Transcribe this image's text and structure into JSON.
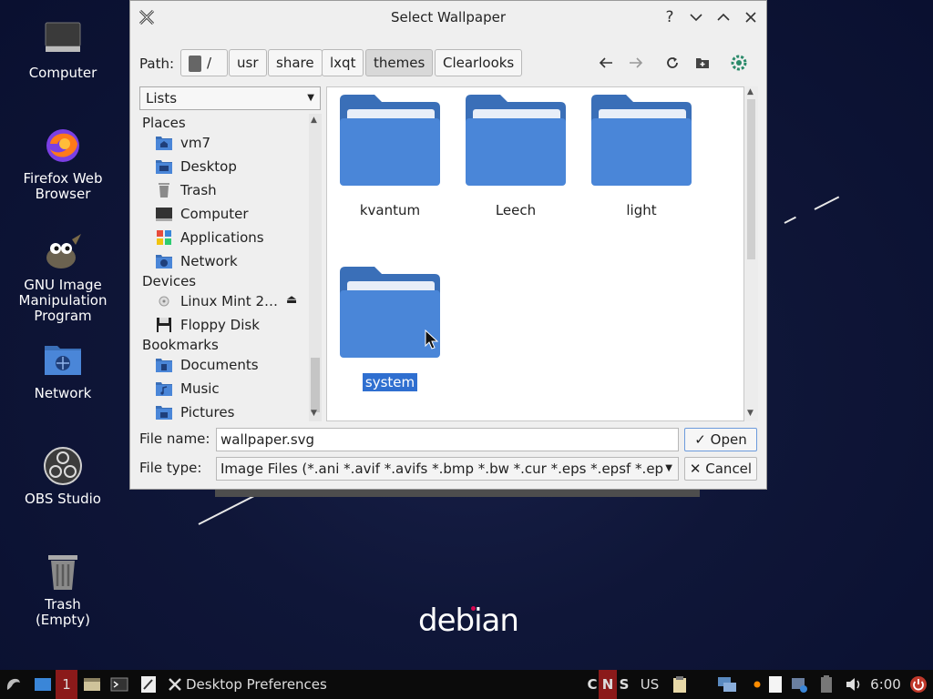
{
  "desktop": {
    "icons": [
      {
        "label": "Computer"
      },
      {
        "label": "Firefox Web Browser"
      },
      {
        "label": "GNU Image Manipulation Program"
      },
      {
        "label": "Network"
      },
      {
        "label": "OBS Studio"
      },
      {
        "label": "Trash (Empty)"
      }
    ],
    "wallpaper_text": "debian"
  },
  "dialog": {
    "title": "Select Wallpaper",
    "path_label": "Path:",
    "breadcrumbs": [
      "/",
      "usr",
      "share",
      "lxqt",
      "themes",
      "Clearlooks"
    ],
    "active_crumb": "themes",
    "view_select": "Lists",
    "sidebar": {
      "places_header": "Places",
      "places": [
        "vm7",
        "Desktop",
        "Trash",
        "Computer",
        "Applications",
        "Network"
      ],
      "devices_header": "Devices",
      "devices": [
        "Linux Mint 2…",
        "Floppy Disk"
      ],
      "bookmarks_header": "Bookmarks",
      "bookmarks": [
        "Documents",
        "Music",
        "Pictures"
      ]
    },
    "folders": [
      "kvantum",
      "Leech",
      "light",
      "system"
    ],
    "selected_folder": "system",
    "file_name_label": "File name:",
    "file_name_value": "wallpaper.svg",
    "file_type_label": "File type:",
    "file_type_value": "Image Files (*.ani *.avif *.avifs *.bmp *.bw *.cur *.eps *.epsf *.ep",
    "open_label": "Open",
    "cancel_label": "Cancel"
  },
  "taskbar": {
    "workspace": "1",
    "task_label": "Desktop Preferences",
    "kbd_c": "C",
    "kbd_n": "N",
    "kbd_s": "S",
    "layout": "US",
    "clock": "6:00"
  },
  "colors": {
    "folder": "#4a86d8",
    "folder_tab": "#3a6fb8",
    "selection": "#2f6fd0",
    "desktop_bg": "#0f1638"
  }
}
